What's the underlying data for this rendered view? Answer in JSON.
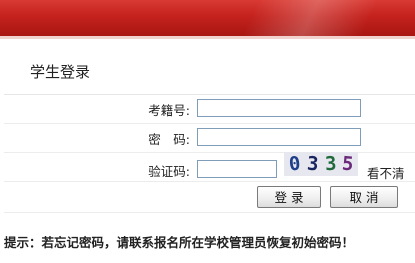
{
  "header": {
    "section_title": "学生登录"
  },
  "form": {
    "exam_number_label": "考籍号:",
    "password_label": "密　码:",
    "captcha_label": "验证码:",
    "exam_number_value": "",
    "password_value": "",
    "captcha_value": "",
    "captcha_image": {
      "chars": [
        "0",
        "3",
        "3",
        "5"
      ],
      "colors": [
        "#1f3f8a",
        "#17245e",
        "#1f6a3a",
        "#6a2a7a"
      ]
    },
    "refresh_label": "看不清",
    "login_button": "登 录",
    "cancel_button": "取 消"
  },
  "footer": {
    "tip": "提示：若忘记密码，请联系报名所在学校管理员恢复初始密码！"
  },
  "colors": {
    "banner": "#c4221d",
    "input_border": "#7f9db9"
  }
}
